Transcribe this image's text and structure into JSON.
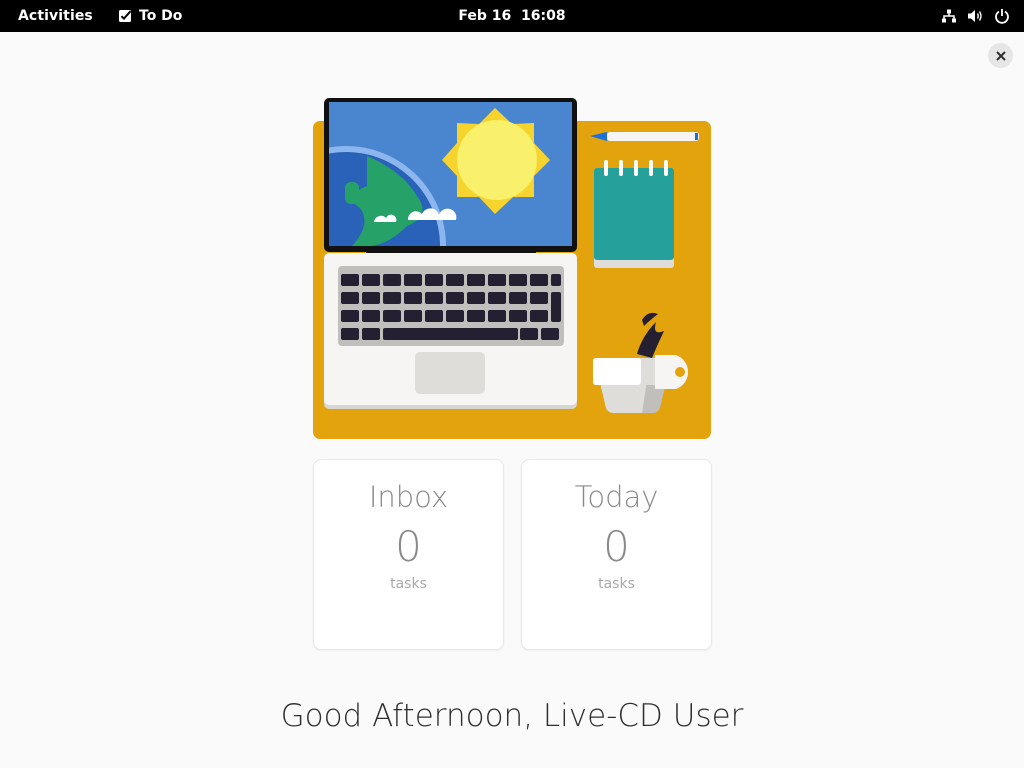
{
  "topbar": {
    "activities": "Activities",
    "app_name": "To Do",
    "clock": "Feb 16  16:08",
    "icons": [
      "network-icon",
      "volume-icon",
      "power-icon"
    ]
  },
  "window": {
    "close_icon": "close-icon"
  },
  "cards": [
    {
      "title": "Inbox",
      "count": "0",
      "unit": "tasks"
    },
    {
      "title": "Today",
      "count": "0",
      "unit": "tasks"
    }
  ],
  "greeting": "Good Afternoon, Live-CD User",
  "colors": {
    "background": "#fafafa",
    "topbar": "#000000",
    "illustration_bg": "#e3a30c",
    "screen": "#4a86d0"
  }
}
